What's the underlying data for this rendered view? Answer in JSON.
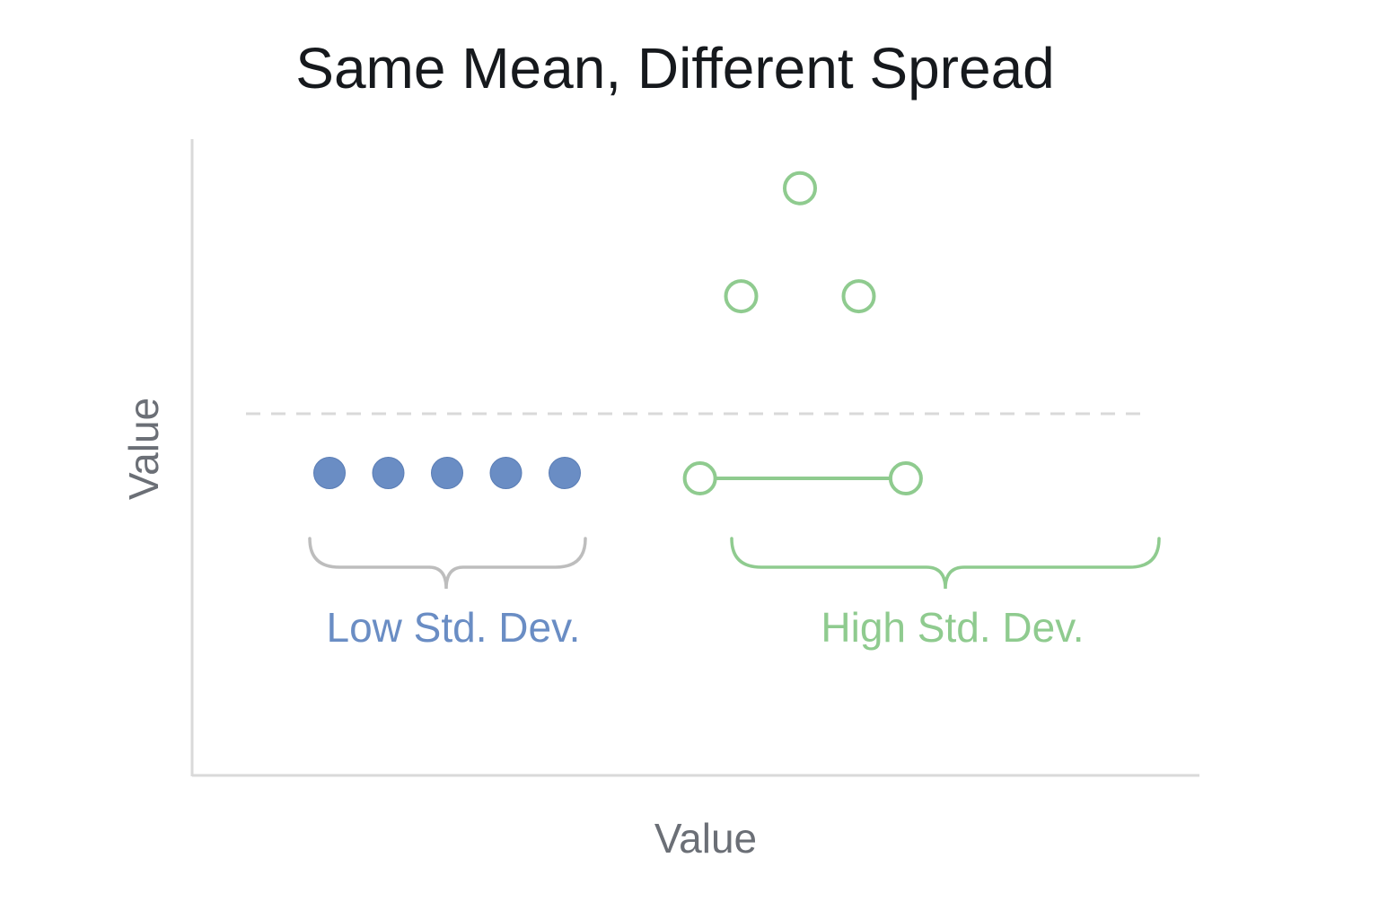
{
  "chart_data": {
    "type": "scatter",
    "title": "Same Mean, Different Spread",
    "xlabel": "Value",
    "ylabel": "Value",
    "grid": false,
    "legend": "none",
    "mean_line": {
      "style": "dashed",
      "color": "#d9d9d9"
    },
    "series": [
      {
        "label": "Low Std. Dev.",
        "color": "#6a8dc4",
        "marker": "filled-circle",
        "points": [
          {
            "x": 1,
            "y": 0
          },
          {
            "x": 2,
            "y": 0
          },
          {
            "x": 3,
            "y": 0
          },
          {
            "x": 4,
            "y": 0
          },
          {
            "x": 5,
            "y": 0
          }
        ]
      },
      {
        "label": "High Std. Dev.",
        "color": "#8fcb8f",
        "marker": "open-circle",
        "points": [
          {
            "x": 7.3,
            "y": 0
          },
          {
            "x": 8,
            "y": 3.6
          },
          {
            "x": 9,
            "y": 5.8
          },
          {
            "x": 10,
            "y": 3.6
          },
          {
            "x": 10.8,
            "y": 0
          }
        ],
        "connect": [
          [
            0,
            4
          ]
        ]
      }
    ],
    "brace_color_low": "#bdbdbd"
  }
}
